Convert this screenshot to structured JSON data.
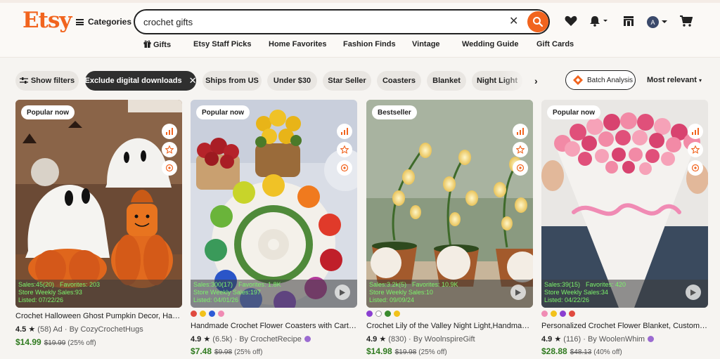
{
  "header": {
    "logo": "Etsy",
    "categories_label": "Categories",
    "search_value": "crochet gifts",
    "cart_avatar_letter": "A"
  },
  "nav": [
    "Gifts",
    "Etsy Staff Picks",
    "Home Favorites",
    "Fashion Finds",
    "Vintage",
    "Wedding Guide",
    "Gift Cards"
  ],
  "filters": {
    "show_filters": "Show filters",
    "active": "Exclude digital downloads",
    "chips": [
      "Ships from US",
      "Under $30",
      "Star Seller",
      "Coasters",
      "Blanket",
      "Night Light"
    ],
    "batch_label": "Batch Analysis",
    "sort_label": "Most relevant"
  },
  "colors": {
    "accent": "#f1641e",
    "price_green": "#2f7a1f",
    "stats_green": "#7cf36b"
  },
  "listings": [
    {
      "badge": "Popular now",
      "sales": "Sales:45(20)",
      "favorites": "Favorites: 203",
      "weekly": "Store Weekly Sales:93",
      "listed": "Listed: 07/22/26",
      "title": "Crochet Halloween Ghost Pumpkin Decor, Handmade...",
      "rating": "4.5",
      "reviews": "(58)",
      "ad": "Ad",
      "shop": "By CozyCrochetHugs",
      "price": "$14.99",
      "was": "$19.99",
      "off": "(25% off)",
      "swatches": []
    },
    {
      "badge": "Popular now",
      "sales": "Sales:300(17)",
      "favorites": "Favorites: 1.8K",
      "weekly": "Store Weekly Sales:197",
      "listed": "Listed: 04/01/26",
      "title": "Handmade Crochet Flower Coasters with Cart Basket...",
      "rating": "4.9",
      "reviews": "(6.5k)",
      "ad": "",
      "shop": "By CrochetRecipe",
      "price": "$7.48",
      "was": "$9.98",
      "off": "(25% off)",
      "swatches": [
        "#e04a3f",
        "#f2c21b",
        "#2e5bd6",
        "#f08bb4"
      ]
    },
    {
      "badge": "Bestseller",
      "sales": "Sales:3.2k(5)",
      "favorites": "Favorites: 10.9K",
      "weekly": "Store Weekly Sales:10",
      "listed": "Listed: 09/09/24",
      "title": "Crochet Lily of the Valley Night Light,Handmade Knit...",
      "rating": "4.9",
      "reviews": "(830)",
      "ad": "",
      "shop": "By WoolnspireGift",
      "price": "$14.98",
      "was": "$19.98",
      "off": "(25% off)",
      "swatches": [
        "#8a3fd1",
        "#ffffff",
        "#3a8a2e",
        "#f2c21b"
      ]
    },
    {
      "badge": "Popular now",
      "sales": "Sales:39(15)",
      "favorites": "Favorites: 420",
      "weekly": "Store Weekly Sales:34",
      "listed": "Listed: 04/22/26",
      "title": "Personalized Crochet Flower Blanket, Custom Name...",
      "rating": "4.9",
      "reviews": "(116)",
      "ad": "",
      "shop": "By WoolenWhim",
      "price": "$28.88",
      "was": "$48.13",
      "off": "(40% off)",
      "swatches": [
        "#f08bb4",
        "#f2c21b",
        "#8a3fd1",
        "#e04a3f"
      ]
    }
  ]
}
